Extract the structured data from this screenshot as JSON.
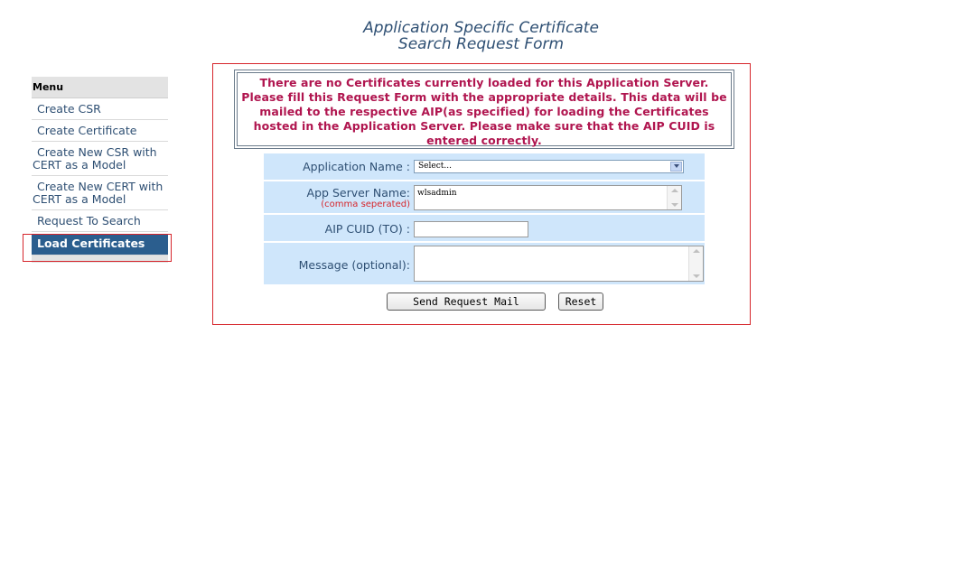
{
  "page": {
    "title_line1": "Application Specific Certificate",
    "title_line2": "Search Request Form"
  },
  "sidebar": {
    "header": "Menu",
    "items": [
      {
        "label": "Create CSR"
      },
      {
        "label": "Create Certificate"
      },
      {
        "label_line1": "Create New CSR with",
        "label_line2": "CERT as a Model"
      },
      {
        "label_line1": "Create New CERT with",
        "label_line2": "CERT as a Model"
      },
      {
        "label": "Request To Search"
      },
      {
        "label": "Load Certificates"
      }
    ]
  },
  "notice": {
    "text": "There are no Certificates currently loaded for this Application Server. Please fill this Request Form with the appropriate details. This data will be mailed to the respective AIP(as specified) for loading the Certificates hosted in the Application Server. Please make sure that the AIP CUID is entered correctly."
  },
  "form": {
    "application_name_label": "Application Name :",
    "application_name_selected": "Select...",
    "app_server_label": "App Server Name:",
    "app_server_note": "(comma seperated)",
    "app_server_value": "wlsadmin",
    "aip_cuid_label": "AIP CUID (TO) :",
    "aip_cuid_value": "",
    "message_label": "Message (optional):",
    "message_value": ""
  },
  "buttons": {
    "send_label": "Send Request Mail",
    "reset_label": "Reset"
  },
  "colors": {
    "title": "#2e4f73",
    "notice_text": "#b0154f",
    "highlight_border": "#d6262c",
    "active_menu_bg": "#2b5e8e",
    "form_bg": "#cfe6fb"
  }
}
